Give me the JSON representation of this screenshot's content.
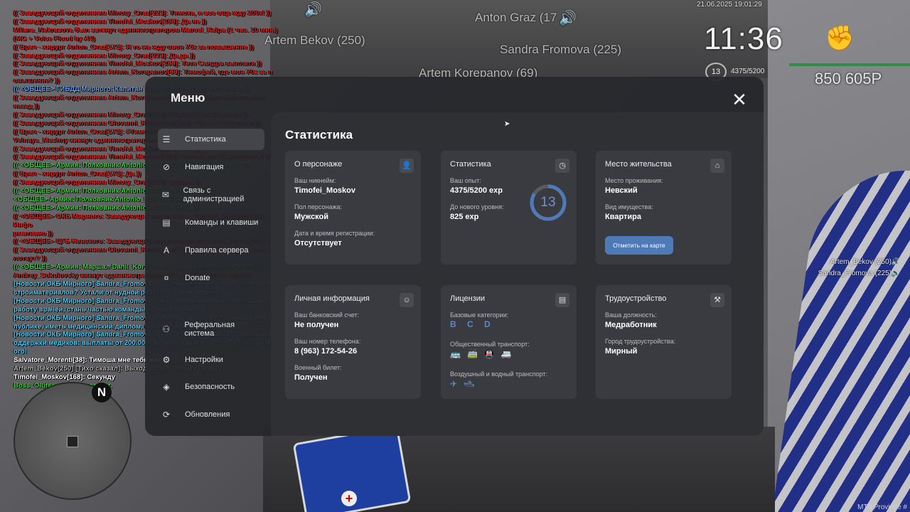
{
  "world": {
    "nametags": [
      "Anton Graz (17",
      "Artem Bekov (250)",
      "Sandra Fromova (225)",
      "Artem Korepanov (69)"
    ]
  },
  "chat": [
    {
      "t": "(( Заведующий отделением Minory_Graz[223]: Тимоха, я все еще жду 200к! ))",
      "c": "#e02020"
    },
    {
      "t": "(( Заведующий отделением Timofei_Moskov[168]: Да не ))",
      "c": "#e02020"
    },
    {
      "t": "Milana_Nekrasova был заткнут администратором Marcel_Kelpa (1 час. 10 мин.)",
      "c": "#e02020"
    },
    {
      "t": "(MG + Voice Flood by AV)",
      "c": "#e02020"
    },
    {
      "t": "(( Врач - хирург Anton_Graz[171]: Я то же жду свои 75к за повышение ))",
      "c": "#e02020"
    },
    {
      "t": "(( Заведующий отделением Minory_Graz[223]: Да,да ))",
      "c": "#e02020"
    },
    {
      "t": "(( Заведующий отделением Timofei_Moskov[168]: Тетя Сандра выплати ))",
      "c": "#e02020"
    },
    {
      "t": "(( Заведующий отделением Artem_Korepanov[69]: Тимофей, где мои 70к за п",
      "c": "#e02020"
    },
    {
      "t": "овышение? ))",
      "c": "#e02020"
    },
    {
      "t": "(( <ОБЩЕЕ> ГИБДД Мирного: Капитан Tyler_Barinov[226]: хулиганка ))",
      "c": "#5aa0ff"
    },
    {
      "t": "(( Заведующий отделением Artem_Korepanov[69]: Я её нашел ещё неделю назад ))",
      "c": "#e02020"
    },
    {
      "t": "(( Заведующий отделением Minory_Graz[223]: #ТимохаГониПремию ))",
      "c": "#e02020"
    },
    {
      "t": "(( Заведующий отделением Giovanni_Rodriguez[126]: #БекавайПремию ))",
      "c": "#e02020"
    },
    {
      "t": "(( Врач - хирург Anton_Graz[171]: #ТимохаГониПремию ))",
      "c": "#e02020"
    },
    {
      "t": "Velnaya_Meshny кикнут администратором Alafy_Storms (AFK 30+)",
      "c": "#e02020"
    },
    {
      "t": "(( Заведующий отделением Timofei_Moskov[168]: Нет ))",
      "c": "#e02020"
    },
    {
      "t": "(( Заведующий отделением Timofei_Moskov[168]: Антиха до ЕС дойдешь? ))",
      "c": "#e02020"
    },
    {
      "t": "(( <ОБЩЕЕ> Армия: Полковник Antonio_Rublsov[53]: Бекон, press F ))",
      "c": "#3ecf3e"
    },
    {
      "t": "(( Врач - хирург Anton_Graz[171]: Да ))",
      "c": "#e02020"
    },
    {
      "t": "(( Заведующий отделением Minory_Graz[223]: Давааа ))",
      "c": "#e02020"
    },
    {
      "t": "(( <ОБЩЕЕ> Армия: Полковник Antonio_Rublsov[53]: тебе ))",
      "c": "#3ecf3e"
    },
    {
      "t": "<ОБЩЕЕ> Армия: Полковник Antonio_Rublsov[53]: ))",
      "c": "#3ecf3e"
    },
    {
      "t": "(( <ОБЩЕЕ> Армия: Полковник Antonio_Rublsov[53]: ))",
      "c": "#3ecf3e"
    },
    {
      "t": "(( <ОБЩЕЕ> ОКБ Мирного: Заведующий отделением Timofei_Moskov[168]: Инфо",
      "c": "#e02020"
    },
    {
      "t": "рмативно ))",
      "c": "#e02020"
    },
    {
      "t": "(( <ОБЩЕЕ> ЦГБ Невского: Заведующий отделением Alexandr_Volsky[10]: :) ))",
      "c": "#e02020"
    },
    {
      "t": "(( Заведующий отделением Giovanni_Rodriguez[126]: В АСМП сваписи или все",
      "c": "#e02020"
    },
    {
      "t": "лотаут? ))",
      "c": "#e02020"
    },
    {
      "t": "(( <ОБЩЕЕ> Армия: Маршал Danil_Korzh[234]: ща вам ворота откроют ))",
      "c": "#3ecf3e"
    },
    {
      "t": "Andrey_Sokolovsky кикнут администратором Aslan_Tarov (Лаги by AV)",
      "c": "#e02020"
    },
    {
      "t": "[Новости ОКБ Мирного] Sandra_Fromova: Постоянно болит спина от переноски",
      "c": "#40d0ff"
    },
    {
      "t": " стройматериалов? Устали от нудной работы в грязном депо?",
      "c": "#40d0ff"
    },
    {
      "t": "[Новости ОКБ Мирного] Sandra_Fromova: ОКБ города Мирный приглашает на",
      "c": "#40d0ff"
    },
    {
      "t": "работу врачей, стань частью команды профессионалов!",
      "c": "#40d0ff"
    },
    {
      "t": "[Новости ОКБ Мирного] Sandra_Fromova: Требования: 5 лет проживания в Рес",
      "c": "#40d0ff"
    },
    {
      "t": "публике, иметь медицинский диплом, паспорт и опрятный вид.",
      "c": "#40d0ff"
    },
    {
      "t": "[Новости ОКБ Мирного] Sandra_Fromova: Действует программа социальной п",
      "c": "#40d0ff"
    },
    {
      "t": "оддержки медиков: выплаты от 200.000 рублей. Ждем в холле больницы Мирн",
      "c": "#40d0ff"
    },
    {
      "t": "ого!",
      "c": "#40d0ff"
    },
    {
      "t": "Salvatore_Morenti[38]: Тимоша мне тебя жалко",
      "c": "#ffffff"
    },
    {
      "t": "Artem_Bekov[250] [Тихо сказал]: Выход есть пропишу Гинару",
      "c": "#b0b0b0"
    },
    {
      "t": "Timofei_Moskov[168]: Секунду",
      "c": "#ffffff"
    },
    {
      "t": "Boss_Olufsen был разоткнут.",
      "c": "#3ecf3e"
    }
  ],
  "hud": {
    "date": "21.06.2025 19:01:29",
    "time": "11:36",
    "level": "13",
    "exp": "4375/5200",
    "money": "850 605Р",
    "hp_fraction": 0.99,
    "voice_players": [
      "Artem_Bekov (250)",
      "Sandra_Fromova (225)"
    ]
  },
  "minimap": {
    "north": "N"
  },
  "watermark": "MTA Province #",
  "menu": {
    "title": "Меню",
    "nav": [
      {
        "label": "Статистика",
        "icon": "chart-icon",
        "glyph": "☰"
      },
      {
        "label": "Навигация",
        "icon": "compass-icon",
        "glyph": "⊘"
      },
      {
        "label": "Связь с администрацией",
        "icon": "chat-icon",
        "glyph": "✉"
      },
      {
        "label": "Команды и клавиши",
        "icon": "keyboard-icon",
        "glyph": "▤"
      },
      {
        "label": "Правила сервера",
        "icon": "rules-icon",
        "glyph": "A"
      },
      {
        "label": "Donate",
        "icon": "donate-icon",
        "glyph": "¤"
      },
      {
        "label": "Реферальная система",
        "icon": "referral-icon",
        "glyph": "⚇"
      },
      {
        "label": "Настройки",
        "icon": "settings-icon",
        "glyph": "⚙"
      },
      {
        "label": "Безопасность",
        "icon": "shield-icon",
        "glyph": "◈"
      },
      {
        "label": "Обновления",
        "icon": "update-icon",
        "glyph": "⟳"
      }
    ],
    "close": "✕",
    "content_title": "Статистика",
    "cards": {
      "person": {
        "title": "О персонаже",
        "nick_label": "Ваш никнейм:",
        "nick": "Timofei_Moskov",
        "gender_label": "Пол персонажа:",
        "gender": "Мужской",
        "reg_label": "Дата и время регистрации:",
        "reg": "Отсутствует"
      },
      "stats": {
        "title": "Статистика",
        "exp_label": "Ваш опыт:",
        "exp": "4375/5200 exp",
        "next_label": "До нового уровня:",
        "next": "825 exp",
        "level": "13",
        "level_progress": 0.84
      },
      "home": {
        "title": "Место жительства",
        "live_label": "Место проживания:",
        "live": "Невский",
        "prop_label": "Вид имущества:",
        "prop": "Квартира",
        "button": "Отметить на карте"
      },
      "personal": {
        "title": "Личная информация",
        "bank_label": "Ваш банковский счет:",
        "bank": "Не получен",
        "phone_label": "Ваш номер телефона:",
        "phone": "8 (963) 172-54-26",
        "military_label": "Военный билет:",
        "military": "Получен"
      },
      "licenses": {
        "title": "Лицензии",
        "base_label": "Базовые категории:",
        "base": "B C D",
        "public_label": "Общественный транспорт:",
        "public_icons": "🚌🚎🚇🚐",
        "air_label": "Воздушный и водный транспорт:",
        "air_icons": "✈🛥"
      },
      "job": {
        "title": "Трудоустройство",
        "post_label": "Ваша должность:",
        "post": "Медработник",
        "city_label": "Город трудоустройства:",
        "city": "Мирный"
      }
    }
  }
}
